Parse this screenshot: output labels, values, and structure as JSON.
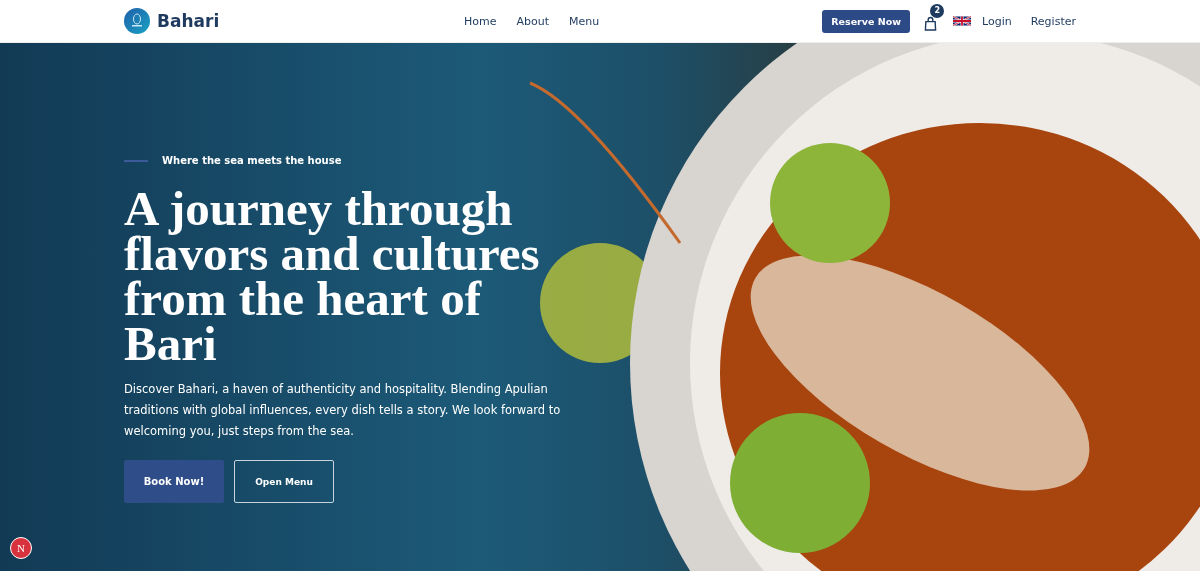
{
  "header": {
    "brand": "Bahari",
    "nav": [
      {
        "label": "Home",
        "selected": false
      },
      {
        "label": "About",
        "selected": false
      },
      {
        "label": "Menu",
        "selected": false
      }
    ],
    "reserve_button": "Reserve Now",
    "cart_count": "2",
    "login": "Login",
    "register": "Register"
  },
  "hero": {
    "tagline": "Where the sea meets the house",
    "headline": "A journey through flavors and cultures from the heart of Bari",
    "description": "Discover Bahari, a haven of authenticity and hospitality. Blending Apulian traditions with global influences, every dish tells a story. We look forward to welcoming you, just steps from the sea.",
    "buttons": [
      {
        "label": "Book Now!",
        "kind": "primary"
      },
      {
        "label": "Open Menu",
        "kind": "outline"
      }
    ]
  },
  "floating_badge": {
    "label": "N"
  }
}
